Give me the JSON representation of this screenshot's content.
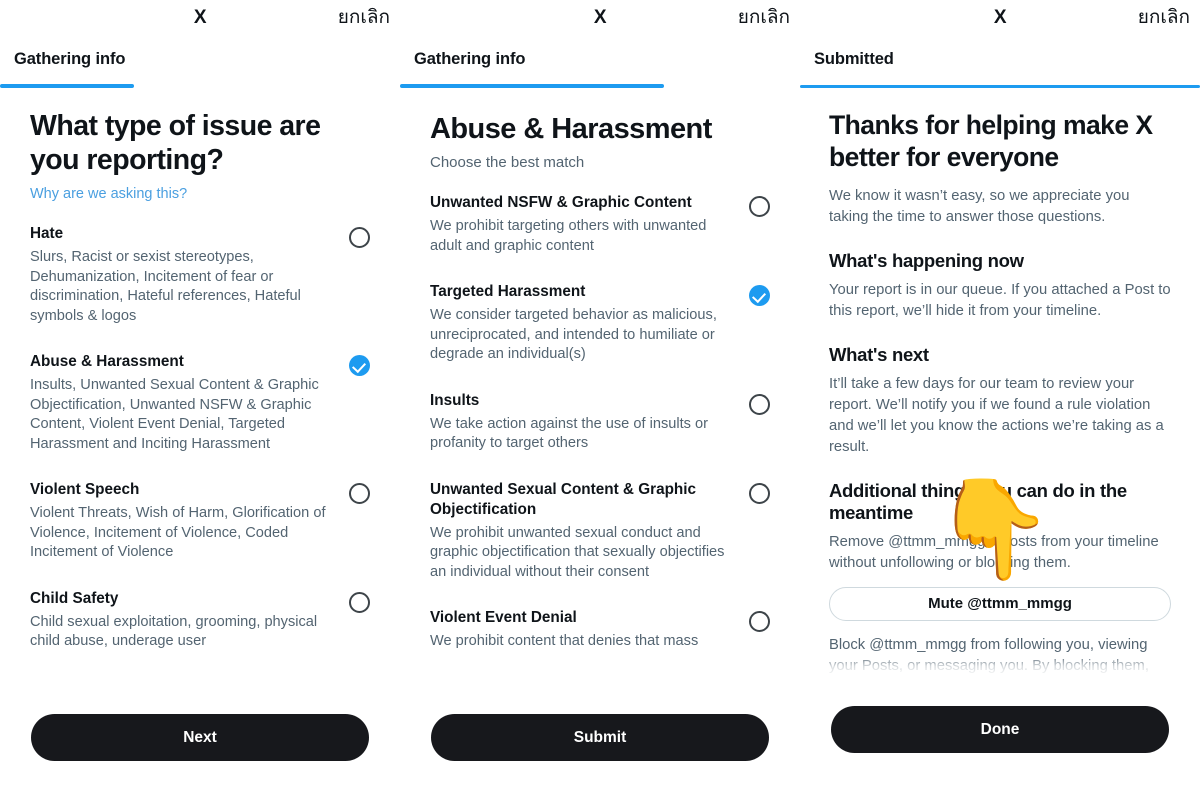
{
  "common": {
    "x_logo": "X",
    "cancel_label": "ยกเลิก"
  },
  "panels": [
    {
      "tab_label": "Gathering info",
      "heading": "What type of issue are you reporting?",
      "why_link": "Why are we asking this?",
      "options": [
        {
          "title": "Hate",
          "desc": "Slurs, Racist or sexist stereotypes, Dehumanization, Incitement of fear or discrimination, Hateful references, Hateful symbols & logos",
          "selected": false
        },
        {
          "title": "Abuse & Harassment",
          "desc": "Insults, Unwanted Sexual Content & Graphic Objectification, Unwanted NSFW & Graphic Content, Violent Event Denial, Targeted Harassment and Inciting Harassment",
          "selected": true
        },
        {
          "title": "Violent Speech",
          "desc": "Violent Threats, Wish of Harm, Glorification of Violence, Incitement of Violence, Coded Incitement of Violence",
          "selected": false
        },
        {
          "title": "Child Safety",
          "desc": "Child sexual exploitation, grooming, physical child abuse, underage user",
          "selected": false
        }
      ],
      "cta_label": "Next"
    },
    {
      "tab_label": "Gathering info",
      "heading": "Abuse & Harassment",
      "subtitle": "Choose the best match",
      "options": [
        {
          "title": "Unwanted NSFW & Graphic Content",
          "desc": "We prohibit targeting others with unwanted adult and graphic content",
          "selected": false
        },
        {
          "title": "Targeted Harassment",
          "desc": "We consider targeted behavior as malicious, unreciprocated, and intended to humiliate or degrade an individual(s)",
          "selected": true
        },
        {
          "title": "Insults",
          "desc": "We take action against the use of insults or profanity to target others",
          "selected": false
        },
        {
          "title": "Unwanted Sexual Content & Graphic Objectification",
          "desc": "We prohibit unwanted sexual conduct and graphic objectification that sexually objectifies an individual without their consent",
          "selected": false
        },
        {
          "title": "Violent Event Denial",
          "desc": "We prohibit content that denies that mass",
          "selected": false
        }
      ],
      "cta_label": "Submit"
    },
    {
      "tab_label": "Submitted",
      "heading": "Thanks for helping make X better for everyone",
      "intro": "We know it wasn’t easy, so we appreciate you taking the time to answer those questions.",
      "sections": [
        {
          "title": "What's happening now",
          "body": "Your report is in our queue. If you attached a Post to this report, we’ll hide it from your timeline."
        },
        {
          "title": "What's next",
          "body": "It’ll take a few days for our team to review your report. We’ll notify you if we found a rule violation and we’ll let you know the actions we’re taking as a result."
        },
        {
          "title": "Additional things you can do in the meantime",
          "body": "Remove @ttmm_mmgg’s Posts from your timeline without unfollowing or blocking them."
        }
      ],
      "mute_button_label": "Mute @ttmm_mmgg",
      "block_text": "Block @ttmm_mmgg from following you, viewing your Posts, or messaging you. By blocking them,",
      "pointer_emoji": "👇",
      "cta_label": "Done"
    }
  ],
  "colors": {
    "accent_blue": "#1d9bf0",
    "link_blue": "#4a9fe0",
    "text_primary": "#0f1419",
    "text_secondary": "#536471",
    "cta_bg": "#17181c"
  }
}
